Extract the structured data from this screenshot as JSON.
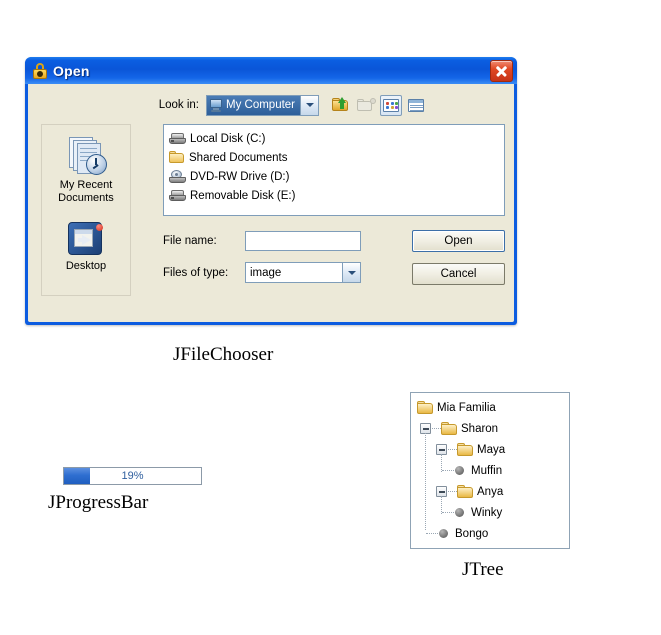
{
  "filechooser": {
    "caption": "JFileChooser",
    "title": "Open",
    "title_icon": "lock-icon",
    "close_icon": "close-icon",
    "lookin": {
      "label": "Look in:",
      "selected": "My Computer",
      "value_icon": "my-computer-icon",
      "arrow_icon": "chevron-down-icon"
    },
    "toolbar": [
      {
        "name": "up-one-level-button",
        "icon": "up-folder-icon",
        "selected": false
      },
      {
        "name": "create-new-folder-button",
        "icon": "new-folder-icon",
        "selected": false
      },
      {
        "name": "list-view-button",
        "icon": "list-view-icon",
        "selected": true
      },
      {
        "name": "details-view-button",
        "icon": "details-view-icon",
        "selected": false
      }
    ],
    "places": [
      {
        "name": "my-recent-documents",
        "icon": "recent-documents-icon",
        "label": "My Recent\nDocuments",
        "line1": "My Recent",
        "line2": "Documents"
      },
      {
        "name": "desktop",
        "icon": "desktop-icon",
        "label": "Desktop",
        "line1": "Desktop",
        "line2": ""
      }
    ],
    "files": [
      {
        "label": "Local Disk (C:)",
        "icon": "hard-disk-icon"
      },
      {
        "label": "Shared Documents",
        "icon": "folder-icon"
      },
      {
        "label": "DVD-RW Drive (D:)",
        "icon": "dvd-drive-icon"
      },
      {
        "label": "Removable Disk (E:)",
        "icon": "hard-disk-icon"
      }
    ],
    "filename": {
      "label": "File name:",
      "value": "",
      "placeholder": ""
    },
    "filetype": {
      "label": "Files of type:",
      "selected": "image",
      "arrow_icon": "chevron-down-icon"
    },
    "buttons": {
      "open": "Open",
      "cancel": "Cancel"
    }
  },
  "progressbar": {
    "caption": "JProgressBar",
    "text": "19%",
    "percent": 19,
    "fill_color": "#2f6fd0",
    "text_color": "#2e5e9e"
  },
  "jtree": {
    "caption": "JTree",
    "nodes": [
      {
        "label": "Mia Familia",
        "icon": "folder-icon",
        "depth": 0,
        "toggle": "none",
        "type": "folder"
      },
      {
        "label": "Sharon",
        "icon": "folder-icon",
        "depth": 1,
        "toggle": "expanded",
        "type": "folder"
      },
      {
        "label": "Maya",
        "icon": "folder-icon",
        "depth": 2,
        "toggle": "expanded",
        "type": "folder"
      },
      {
        "label": "Muffin",
        "icon": "leaf-icon",
        "depth": 3,
        "toggle": "none",
        "type": "leaf"
      },
      {
        "label": "Anya",
        "icon": "folder-icon",
        "depth": 2,
        "toggle": "expanded",
        "type": "folder"
      },
      {
        "label": "Winky",
        "icon": "leaf-icon",
        "depth": 3,
        "toggle": "none",
        "type": "leaf"
      },
      {
        "label": "Bongo",
        "icon": "leaf-icon",
        "depth": 2,
        "toggle": "none",
        "type": "leaf"
      }
    ]
  }
}
